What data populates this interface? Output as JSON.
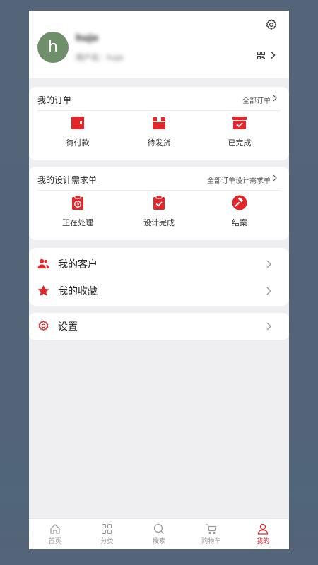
{
  "profile": {
    "avatar_letter": "h",
    "username": "hujo",
    "account_label": "用户名：hujo"
  },
  "orders": {
    "title": "我的订单",
    "link": "全部订单",
    "items": [
      {
        "label": "待付款",
        "icon": "wallet-icon"
      },
      {
        "label": "待发货",
        "icon": "box-icon"
      },
      {
        "label": "已完成",
        "icon": "box-check-icon"
      }
    ]
  },
  "design": {
    "title": "我的设计需求单",
    "link": "全部订单设计需求单",
    "items": [
      {
        "label": "正在处理",
        "icon": "clipboard-clock-icon"
      },
      {
        "label": "设计完成",
        "icon": "clipboard-check-icon"
      },
      {
        "label": "结案",
        "icon": "gavel-icon"
      }
    ]
  },
  "menu": {
    "customers": "我的客户",
    "favorites": "我的收藏",
    "settings": "设置"
  },
  "tabs": [
    {
      "label": "首页",
      "icon": "home-icon"
    },
    {
      "label": "分类",
      "icon": "category-icon"
    },
    {
      "label": "搜索",
      "icon": "search-icon"
    },
    {
      "label": "购物车",
      "icon": "cart-icon"
    },
    {
      "label": "我的",
      "icon": "user-icon",
      "active": true
    }
  ],
  "colors": {
    "accent": "#e3262a",
    "background": "#efeff1"
  }
}
